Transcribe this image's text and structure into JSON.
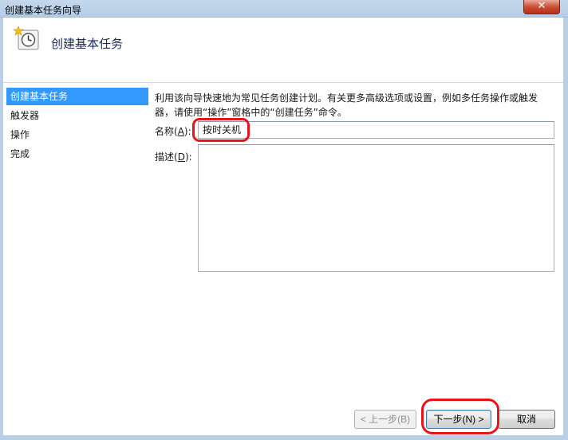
{
  "window": {
    "title": "创建基本任务向导",
    "close_glyph": "✕"
  },
  "header": {
    "title": "创建基本任务",
    "icon": "task-clock-icon"
  },
  "sidebar": {
    "items": [
      {
        "label": "创建基本任务",
        "active": true
      },
      {
        "label": "触发器",
        "active": false
      },
      {
        "label": "操作",
        "active": false
      },
      {
        "label": "完成",
        "active": false
      }
    ]
  },
  "form": {
    "description_line1": "利用该向导快速地为常见任务创建计划。有关更多高级选项或设置，例如多任务操作或触发",
    "description_line2": "器，请使用“操作”窗格中的“创建任务”命令。",
    "name_label_prefix": "名称(",
    "name_label_key": "A",
    "name_label_suffix": "):",
    "name_value": "按时关机",
    "desc_label_prefix": "描述(",
    "desc_label_key": "D",
    "desc_label_suffix": "):",
    "desc_value": ""
  },
  "buttons": {
    "back": "< 上一步(B)",
    "next": "下一步(N) >",
    "cancel": "取消"
  },
  "colors": {
    "accent": "#3399ff",
    "highlight_red": "#e8141a"
  }
}
